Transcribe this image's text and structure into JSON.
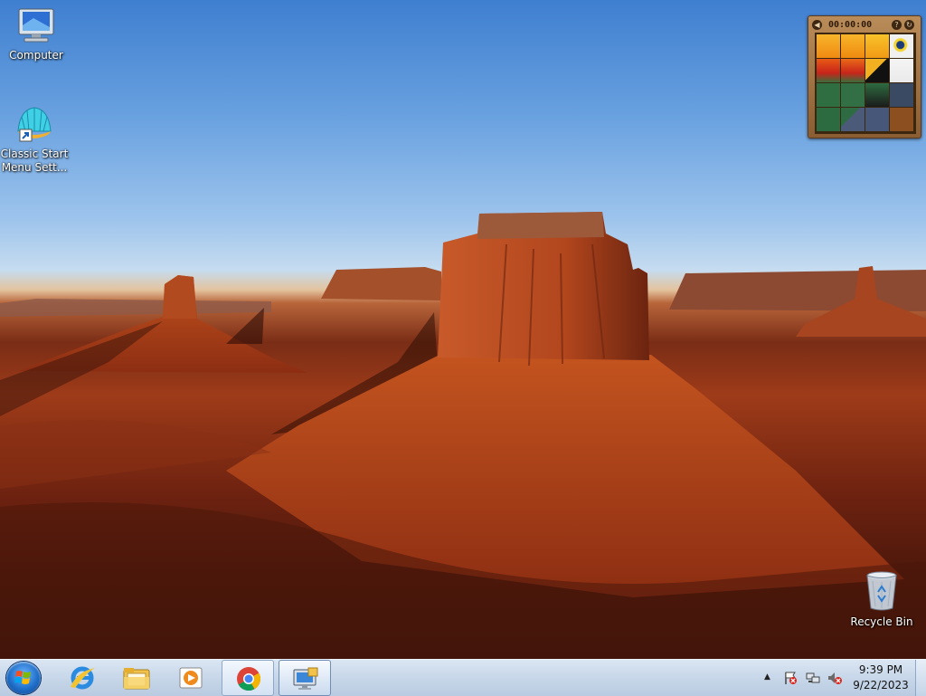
{
  "desktop": {
    "icons": [
      {
        "label": "Computer",
        "icon": "computer-icon"
      },
      {
        "label": "Classic Start\nMenu Sett...",
        "icon": "shell-icon"
      },
      {
        "label": "Recycle Bin",
        "icon": "recycle-bin-icon"
      }
    ]
  },
  "gadget": {
    "timer": "00:00:00",
    "help_symbol": "?",
    "refresh_symbol": "↻",
    "icon": "puzzle-gadget-icon"
  },
  "taskbar": {
    "pinned": [
      {
        "icon": "internet-explorer-icon"
      },
      {
        "icon": "file-explorer-icon"
      },
      {
        "icon": "media-player-icon"
      },
      {
        "icon": "chrome-icon"
      },
      {
        "icon": "remote-desktop-icon"
      }
    ],
    "tray": {
      "show_hidden": "▲",
      "icons": [
        "action-center-icon",
        "network-icon",
        "volume-muted-icon"
      ]
    },
    "clock": {
      "time": "9:39 PM",
      "date": "9/22/2023"
    }
  }
}
